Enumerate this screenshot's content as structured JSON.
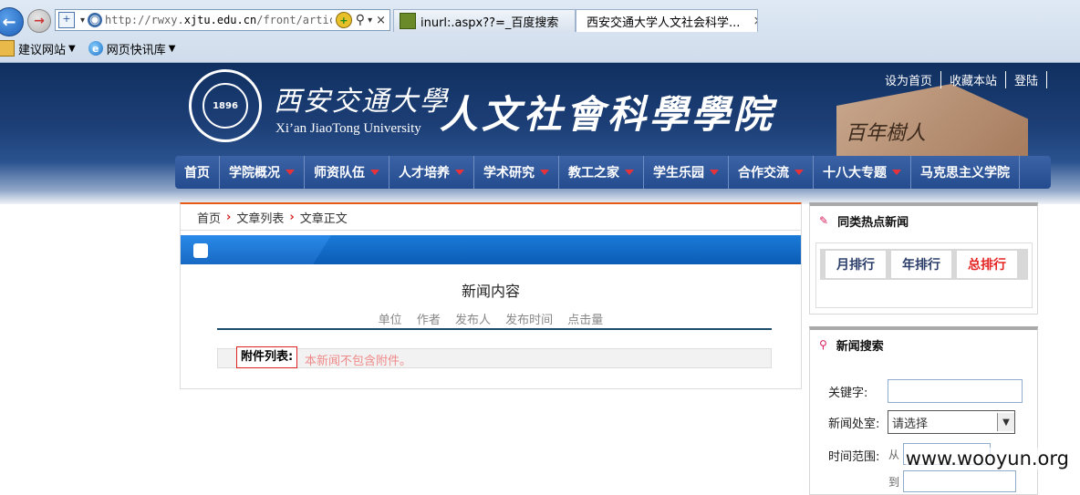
{
  "browser": {
    "url_prefix": "http://rwxy.",
    "url_domain": "xjtu.edu.cn",
    "url_path": "/front/articlenews",
    "tabs": [
      {
        "title": "inurl:.aspx??=_百度搜索"
      },
      {
        "title": "西安交通大学人文社会科学..."
      }
    ],
    "close_glyph": "×",
    "favorites": [
      {
        "label": "建议网站"
      },
      {
        "label": "网页快讯库"
      }
    ]
  },
  "header": {
    "uni_cn": "西安交通大學",
    "uni_en": "Xi’an JiaoTong University",
    "college": "人文社會科學學院",
    "stone_text": "百年樹人",
    "top_links": [
      "设为首页",
      "收藏本站",
      "登陆"
    ]
  },
  "nav": {
    "items": [
      {
        "label": "首页",
        "dropdown": false
      },
      {
        "label": "学院概况",
        "dropdown": true
      },
      {
        "label": "师资队伍",
        "dropdown": true
      },
      {
        "label": "人才培养",
        "dropdown": true
      },
      {
        "label": "学术研究",
        "dropdown": true
      },
      {
        "label": "教工之家",
        "dropdown": true
      },
      {
        "label": "学生乐园",
        "dropdown": true
      },
      {
        "label": "合作交流",
        "dropdown": true
      },
      {
        "label": "十八大专题",
        "dropdown": true
      },
      {
        "label": "马克思主义学院",
        "dropdown": false
      }
    ]
  },
  "breadcrumb": [
    "首页",
    "文章列表",
    "文章正文"
  ],
  "article": {
    "title": "新闻内容",
    "meta": [
      "单位",
      "作者",
      "发布人",
      "发布时间",
      "点击量"
    ],
    "attachment_label": "附件列表:",
    "attachment_value": "本新闻不包含附件。"
  },
  "sidebar": {
    "hot_title": "同类热点新闻",
    "rank_tabs": [
      {
        "label": "月排行",
        "active": false
      },
      {
        "label": "年排行",
        "active": false
      },
      {
        "label": "总排行",
        "active": true
      }
    ],
    "search_title": "新闻搜索",
    "keyword_label": "关键字:",
    "keyword_value": "",
    "dept_label": "新闻处室:",
    "dept_selected": "请选择",
    "range_label": "时间范围:",
    "from_label": "从",
    "to_label": "到"
  },
  "watermark": "www.wooyun.org",
  "colors": {
    "header_dark": "#103060",
    "nav_blue": "#234b8e",
    "accent_red": "#e52424",
    "bar_blue": "#0b5cb5"
  }
}
